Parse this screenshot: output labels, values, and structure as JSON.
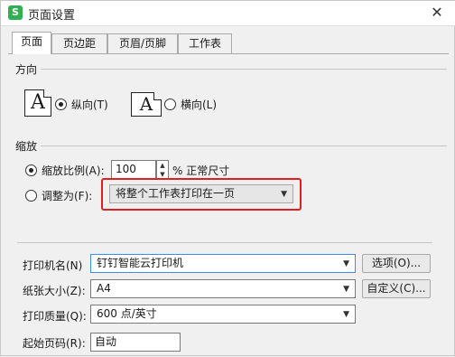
{
  "window": {
    "title": "页面设置",
    "app_icon_letter": "S"
  },
  "tabs": [
    "页面",
    "页边距",
    "页眉/页脚",
    "工作表"
  ],
  "orientation": {
    "group_title": "方向",
    "page_glyph": "A",
    "portrait_label": "纵向(T)",
    "landscape_label": "横向(L)",
    "selected": "portrait"
  },
  "scaling": {
    "group_title": "缩放",
    "scale_label": "缩放比例(A):",
    "scale_value": "100",
    "scale_suffix": "% 正常尺寸",
    "fit_label": "调整为(F):",
    "fit_option": "将整个工作表打印在一页",
    "selected": "scale"
  },
  "printer": {
    "name_label": "打印机名(N)",
    "name_value": "钉钉智能云打印机",
    "options_button": "选项(O)...",
    "paper_label": "纸张大小(Z):",
    "paper_value": "A4",
    "custom_button": "自定义(C)...",
    "quality_label": "打印质量(Q):",
    "quality_value": "600 点/英寸",
    "start_page_label": "起始页码(R):",
    "start_page_value": "自动"
  },
  "colors": {
    "highlight": "#e02020",
    "accent_blue": "#3c8ee8",
    "app_green": "#2fb052"
  }
}
